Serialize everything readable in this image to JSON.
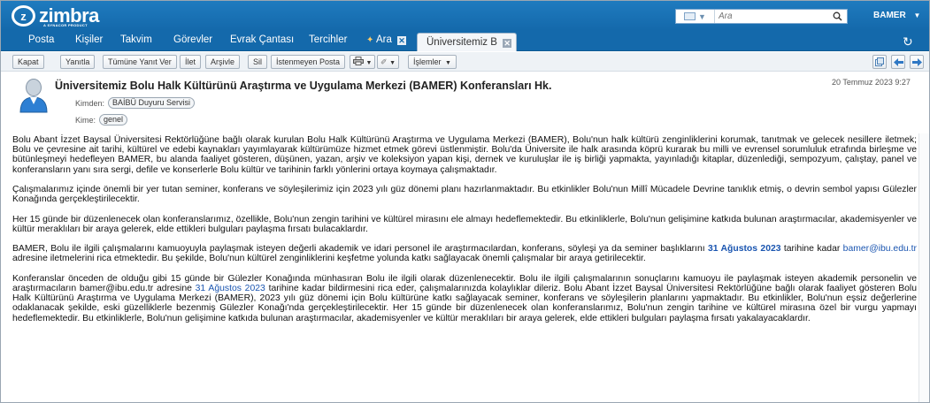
{
  "app": {
    "logo_text": "zimbra",
    "logo_subtitle": "A SYNACOR PRODUCT"
  },
  "search": {
    "placeholder": "Ara",
    "type_dropdown": "▼"
  },
  "user": {
    "name": "BAMER",
    "dropdown": "▼"
  },
  "tabs": [
    {
      "label": "Posta"
    },
    {
      "label": "Kişiler"
    },
    {
      "label": "Takvim"
    },
    {
      "label": "Görevler"
    },
    {
      "label": "Evrak Çantası"
    },
    {
      "label": "Tercihler"
    },
    {
      "label": "Ara"
    },
    {
      "label": "Üniversitemiz B"
    }
  ],
  "toolbar": {
    "close": "Kapat",
    "reply": "Yanıtla",
    "reply_all": "Tümüne Yanıt Ver",
    "forward": "İlet",
    "archive": "Arşivle",
    "delete": "Sil",
    "spam": "İstenmeyen Posta",
    "actions": "İşlemler",
    "dropdown": "▼"
  },
  "message": {
    "subject": "Üniversitemiz Bolu Halk Kültürünü Araştırma ve Uygulama Merkezi (BAMER) Konferansları Hk.",
    "date": "20 Temmuz 2023 9:27",
    "from_label": "Kimden:",
    "from_value": "BAİBÜ Duyuru Servisi",
    "to_label": "Kime:",
    "to_value": "genel",
    "paragraphs": {
      "p1": "Bolu Abant İzzet Baysal Üniversitesi Rektörlüğüne bağlı olarak kurulan Bolu Halk Kültürünü Araştırma ve Uygulama Merkezi (BAMER), Bolu'nun halk kültürü zenginliklerini korumak, tanıtmak ve gelecek nesillere iletmek; Bolu ve çevresine ait tarihi, kültürel ve edebi kaynakları yayımlayarak kültürümüze hizmet etmek görevi üstlenmiştir. Bolu'da Üniversite ile halk arasında köprü kurarak bu milli ve evrensel sorumluluk etrafında birleşme ve bütünleşmeyi hedefleyen BAMER, bu alanda faaliyet gösteren, düşünen, yazan, arşiv ve koleksiyon yapan kişi, dernek ve kuruluşlar ile iş birliği yapmakta, yayınladığı kitaplar, düzenlediği, sempozyum, çalıştay, panel ve konferansların yanı sıra sergi, defile ve konserlerle Bolu kültür ve tarihinin farklı yönlerini ortaya koymaya çalışmaktadır.",
      "p2": "Çalışmalarımız içinde önemli bir yer tutan seminer, konferans ve söyleşilerimiz için 2023 yılı güz dönemi planı hazırlanmaktadır. Bu etkinlikler Bolu'nun Millî Mücadele Devrine tanıklık etmiş, o devrin sembol yapısı Gülezler Konağında gerçekleştirilecektir.",
      "p3": "Her 15 günde bir düzenlenecek olan konferanslarımız, özellikle, Bolu'nun zengin tarihini ve kültürel mirasını ele almayı hedeflemektedir. Bu etkinliklerle, Bolu'nun gelişimine katkıda bulunan araştırmacılar, akademisyenler ve kültür meraklıları bir araya gelerek, elde ettikleri bulguları paylaşma fırsatı bulacaklardır.",
      "p4a": "BAMER, Bolu ile ilgili çalışmalarını kamuoyuyla paylaşmak isteyen değerli akademik ve idari personel ile araştırmacılardan, konferans, söyleşi ya da seminer başlıklarını ",
      "p4_date": "31 Ağustos 2023",
      "p4b": " tarihine kadar ",
      "p4_email": "bamer@ibu.edu.tr",
      "p4c": " adresine iletmelerini rica etmektedir. Bu şekilde, Bolu'nun kültürel zenginliklerini keşfetme yolunda katkı sağlayacak önemli çalışmalar bir araya getirilecektir.",
      "p5a": "Konferanslar önceden de olduğu gibi 15 günde bir Gülezler Konağında münhasıran Bolu ile ilgili olarak düzenlenecektir. Bolu ile ilgili çalışmalarının sonuçlarını kamuoyu ile paylaşmak isteyen akademik personelin ve araştırmacıların bamer@ibu.edu.tr adresine ",
      "p5_date": "31 Ağustos 2023",
      "p5b": " tarihine kadar bildirmesini rica eder, çalışmalarınızda kolaylıklar dileriz. Bolu Abant İzzet Baysal Üniversitesi Rektörlüğüne bağlı olarak faaliyet gösteren Bolu Halk Kültürünü Araştırma ve Uygulama Merkezi (BAMER), 2023 yılı güz dönemi için Bolu kültürüne katkı sağlayacak seminer, konferans ve söyleşilerin planlarını yapmaktadır. Bu etkinlikler, Bolu'nun eşsiz değerlerine odaklanacak şekilde, eski güzelliklerle bezenmiş Gülezler Konağı'nda gerçekleştirilecektir. Her 15 günde bir düzenlenecek olan konferanslarımız, Bolu'nun zengin tarihine ve kültürel mirasına özel bir vurgu yapmayı hedeflemektedir. Bu etkinliklerle, Bolu'nun gelişimine katkıda bulunan araştırmacılar, akademisyenler ve kültür meraklıları bir araya gelerek, elde ettikleri bulguları paylaşma fırsatı yakalayacaklardır."
    }
  }
}
